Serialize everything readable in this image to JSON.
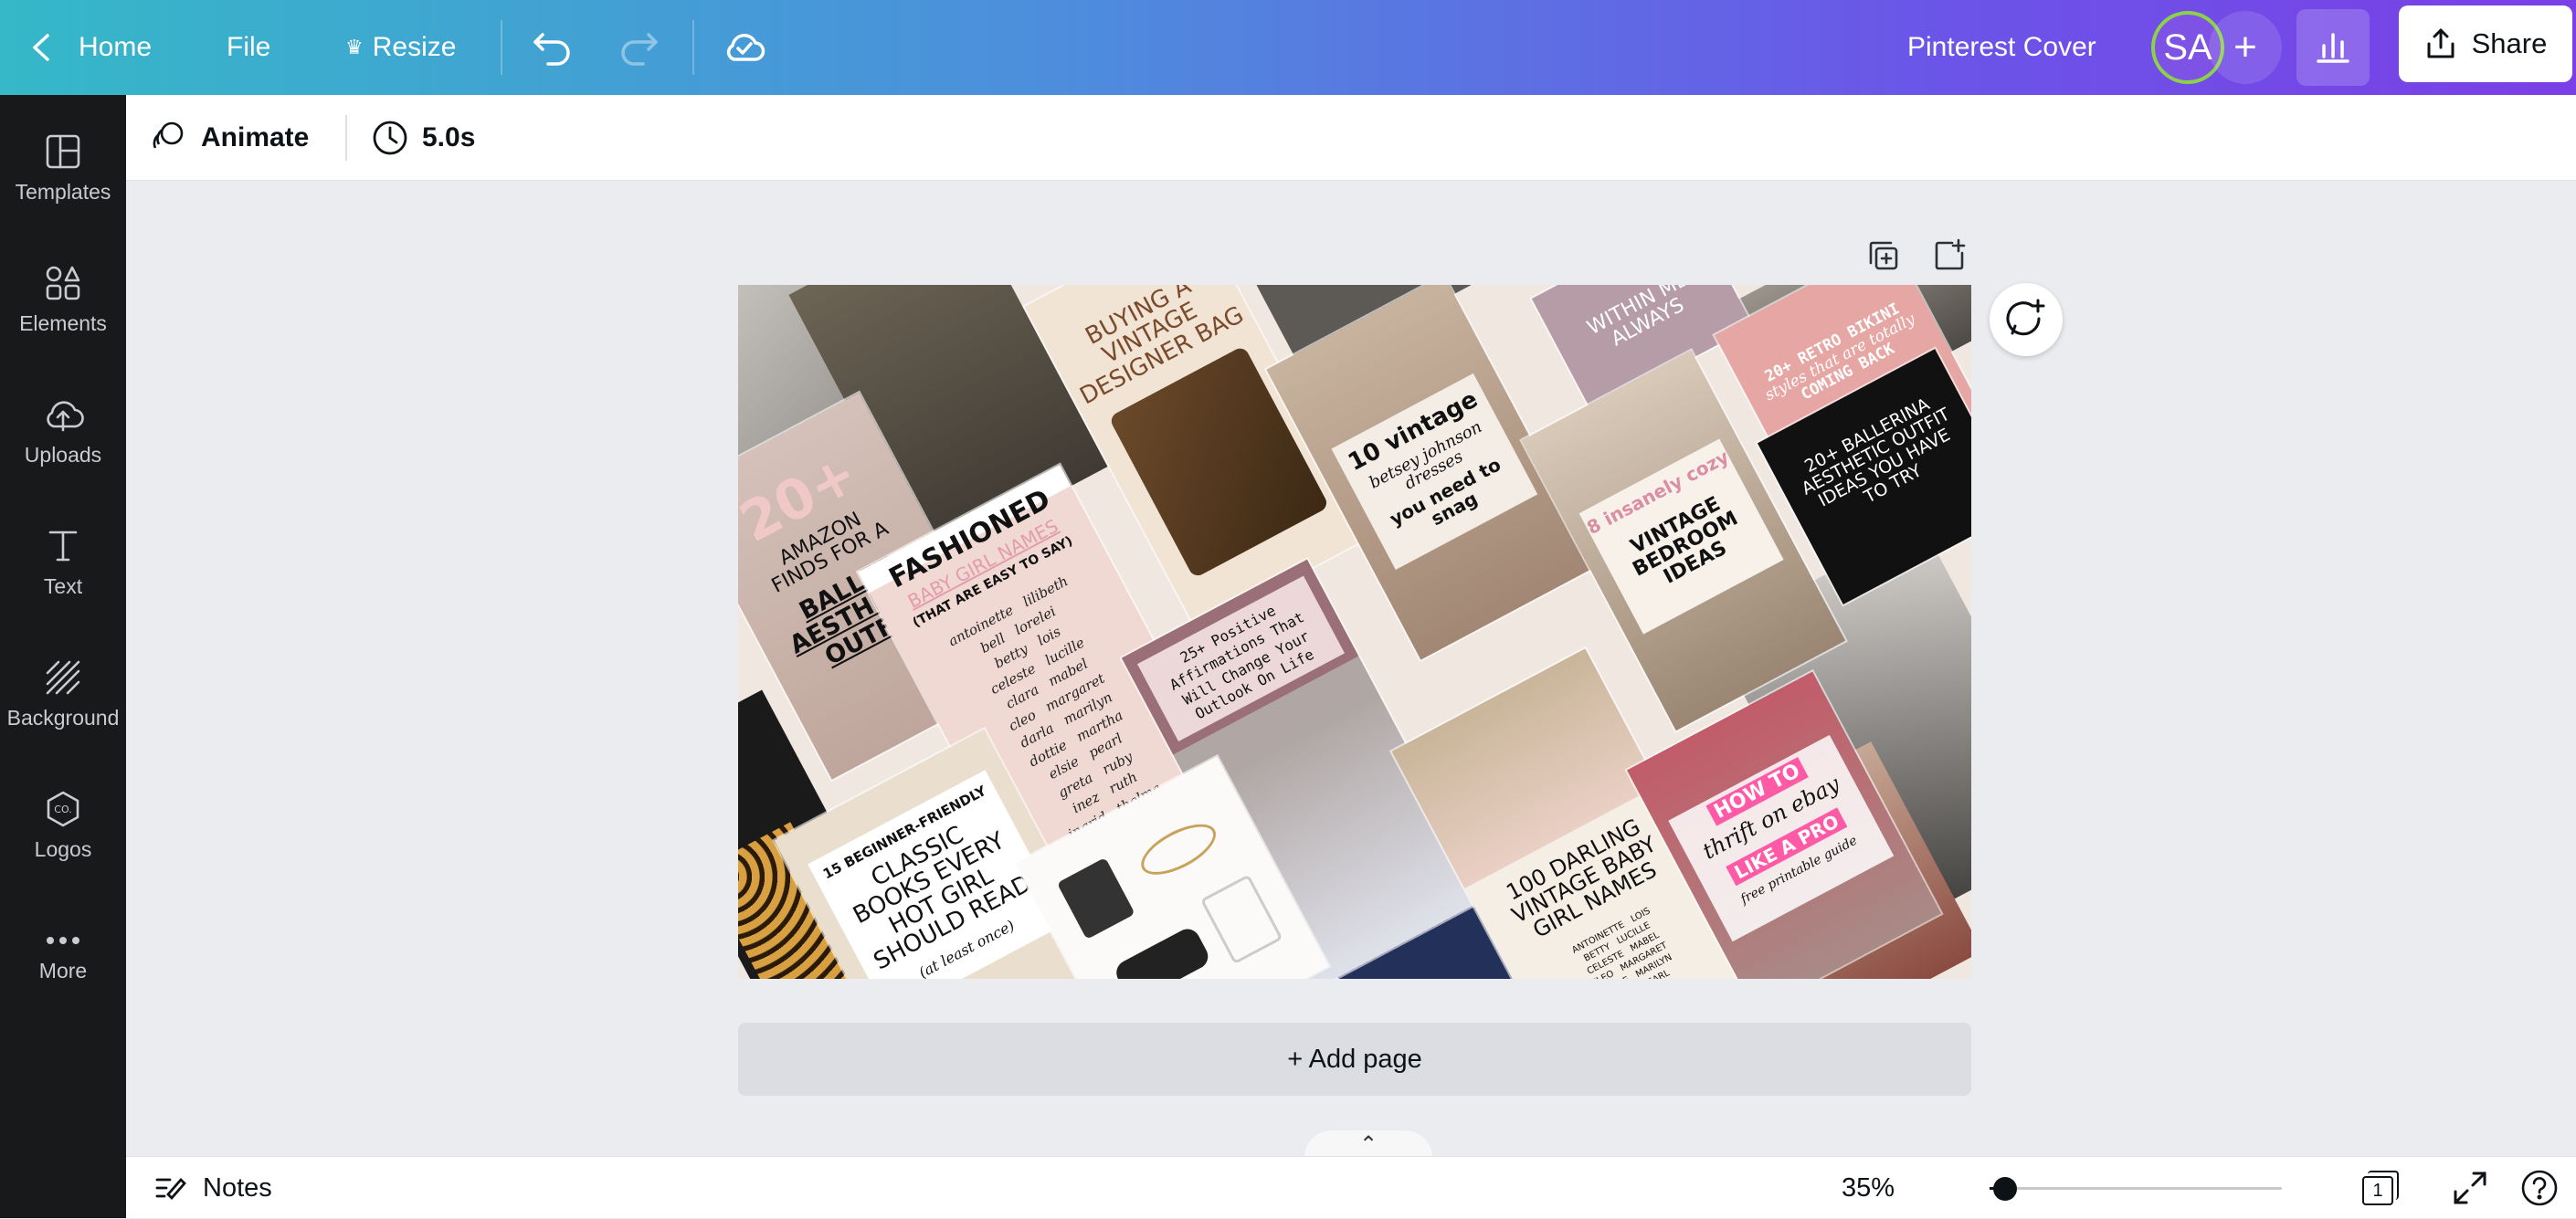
{
  "topbar": {
    "home_label": "Home",
    "file_label": "File",
    "resize_label": "Resize",
    "doc_title": "Pinterest Cover",
    "avatar_initials": "SA",
    "share_label": "Share"
  },
  "sidebar": {
    "items": [
      {
        "label": "Templates",
        "icon": "templates-icon"
      },
      {
        "label": "Elements",
        "icon": "elements-icon"
      },
      {
        "label": "Uploads",
        "icon": "uploads-icon"
      },
      {
        "label": "Text",
        "icon": "text-icon"
      },
      {
        "label": "Background",
        "icon": "background-icon"
      },
      {
        "label": "Logos",
        "icon": "logos-icon"
      },
      {
        "label": "More",
        "icon": "more-icon"
      }
    ]
  },
  "context_bar": {
    "animate_label": "Animate",
    "duration_label": "5.0s"
  },
  "canvas": {
    "add_page_label": "+ Add page",
    "pins": [
      {
        "lines": [
          "BUYING A VINTAGE",
          "DESIGNER BAG"
        ]
      },
      {
        "lines": [
          "20+",
          "AMAZON",
          "FINDS FOR A",
          "BALLET",
          "AESTHETIC",
          "OUTFIT"
        ]
      },
      {
        "lines": [
          "FASHIONED",
          "BABY GIRL NAMES",
          "(THAT ARE EASY TO SAY)"
        ]
      },
      {
        "lines": [
          "10 vintage",
          "betsey johnson",
          "dresses",
          "you need to",
          "snag"
        ]
      },
      {
        "lines": [
          "25+ Positive",
          "Affirmations That",
          "Will Change Your",
          "Outlook On Life"
        ]
      },
      {
        "lines": [
          "8 insanely cozy",
          "VINTAGE",
          "BEDROOM",
          "IDEAS"
        ]
      },
      {
        "lines": [
          "20+ RETRO BIKINI",
          "styles that are totally",
          "COMING BACK"
        ]
      },
      {
        "lines": [
          "20+ BALLERINA",
          "AESTHETIC OUTFIT",
          "IDEAS YOU HAVE",
          "TO TRY"
        ]
      },
      {
        "lines": [
          "15 BEGINNER-FRIENDLY",
          "CLASSIC",
          "BOOKS EVERY",
          "HOT GIRL",
          "SHOULD READ",
          "(at least once)"
        ]
      },
      {
        "lines": [
          "100 DARLING",
          "VINTAGE BABY",
          "GIRL NAMES"
        ]
      },
      {
        "lines": [
          "HOW TO",
          "thrift on ebay",
          "LIKE A PRO",
          "free printable guide"
        ]
      },
      {
        "lines": [
          "WITHIN ME",
          "ALWAYS"
        ]
      }
    ]
  },
  "bottombar": {
    "notes_label": "Notes",
    "zoom_label": "35%",
    "zoom_fraction": 0.35,
    "page_count": "1"
  }
}
